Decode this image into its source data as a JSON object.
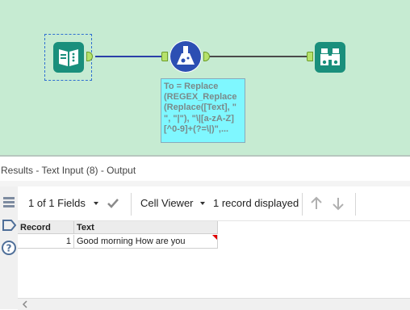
{
  "workflow": {
    "annotation_text": "To = Replace\n(REGEX_Replace\n(Replace([Text], \"\n\", \"|\"), \"\\|[a-zA-Z]\n[^0-9]+(?=\\|)\",...",
    "colors": {
      "canvas": "#c6ebd2",
      "tool_teal": "#1a8f7c",
      "annotation_bg": "#7ff7ff",
      "connector_blue": "#2a3fa8",
      "connector_dark": "#4a4a4a"
    },
    "tools": [
      {
        "name": "text-input-tool",
        "icon": "book-icon"
      },
      {
        "name": "formula-tool",
        "icon": "flask-icon"
      },
      {
        "name": "browse-tool",
        "icon": "binoculars-icon"
      }
    ]
  },
  "results": {
    "title": "Results - Text Input (8) - Output",
    "toolbar": {
      "fields_label": "1 of 1 Fields",
      "viewer_label": "Cell Viewer",
      "record_count": "1 record displayed"
    },
    "table": {
      "columns": [
        "Record",
        "Text"
      ],
      "rows": [
        {
          "record": "1",
          "text": "Good morning How are you"
        }
      ]
    }
  }
}
